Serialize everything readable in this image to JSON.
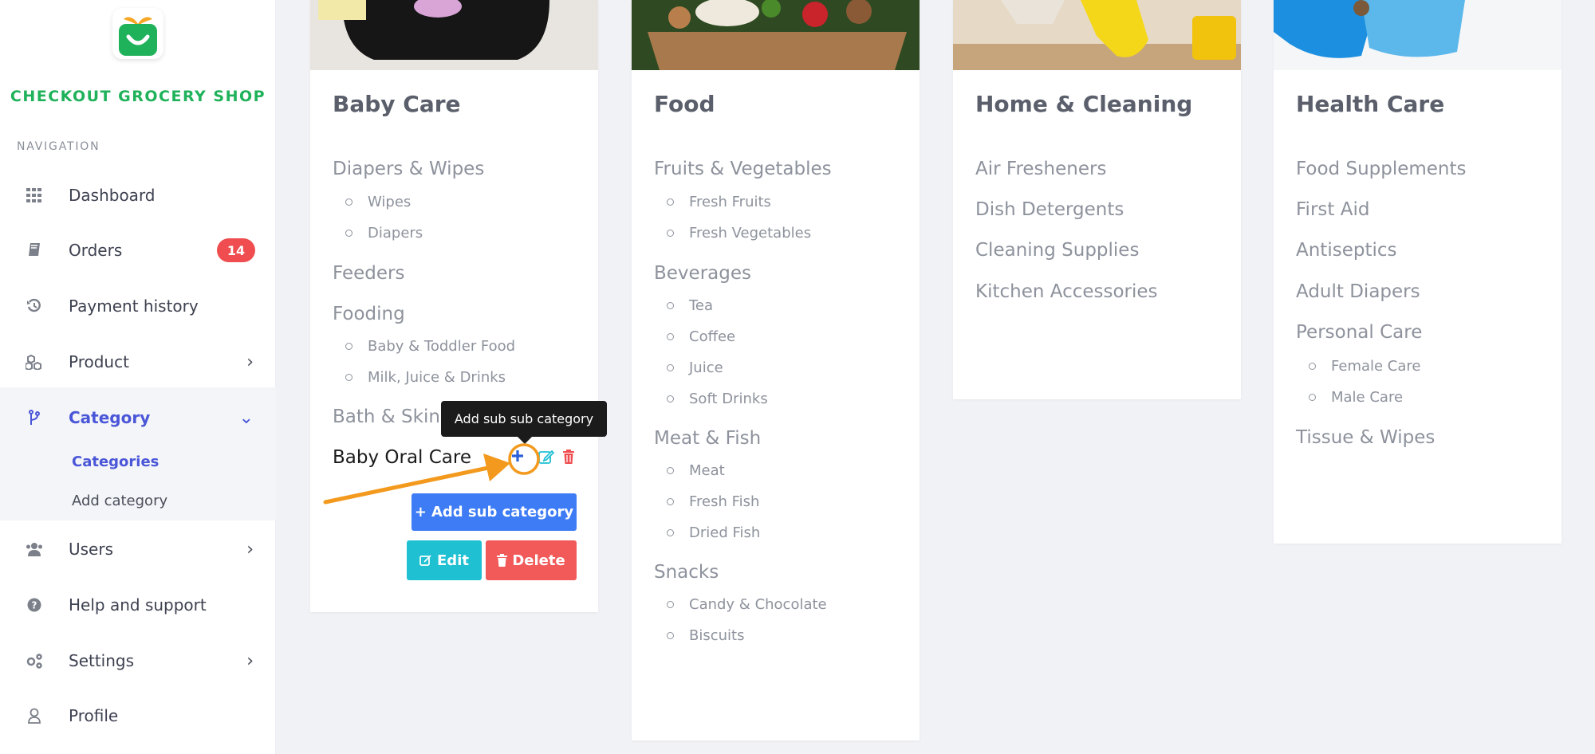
{
  "brand": {
    "name": "CHECKOUT GROCERY SHOP"
  },
  "sidebar": {
    "section_heading": "NAVIGATION",
    "items": [
      {
        "label": "Dashboard",
        "icon": "grid-icon"
      },
      {
        "label": "Orders",
        "icon": "book-icon",
        "badge": "14"
      },
      {
        "label": "Payment history",
        "icon": "history-icon"
      },
      {
        "label": "Product",
        "icon": "cubes-icon"
      },
      {
        "label": "Category",
        "icon": "branch-icon",
        "expanded": true,
        "subitems": [
          {
            "label": "Categories",
            "active": true
          },
          {
            "label": "Add category"
          }
        ]
      },
      {
        "label": "Users",
        "icon": "users-icon"
      },
      {
        "label": "Help and support",
        "icon": "question-circle-icon"
      },
      {
        "label": "Settings",
        "icon": "gears-icon"
      },
      {
        "label": "Profile",
        "icon": "user-outline-icon"
      }
    ]
  },
  "categories": {
    "baby_care": {
      "title": "Baby Care",
      "groups": [
        {
          "name": "Diapers & Wipes",
          "children": [
            "Wipes",
            "Diapers"
          ]
        },
        {
          "name": "Feeders",
          "children": []
        },
        {
          "name": "Fooding",
          "children": [
            "Baby & Toddler Food",
            "Milk, Juice & Drinks"
          ]
        },
        {
          "name": "Bath & Skincare",
          "children": []
        },
        {
          "name": "Baby Oral Care",
          "children": []
        }
      ],
      "add_sub_label": "Add sub category",
      "edit_label": "Edit",
      "delete_label": "Delete",
      "tooltip": "Add sub sub category"
    },
    "food": {
      "title": "Food",
      "groups": [
        {
          "name": "Fruits & Vegetables",
          "children": [
            "Fresh Fruits",
            "Fresh Vegetables"
          ]
        },
        {
          "name": "Beverages",
          "children": [
            "Tea",
            "Coffee",
            "Juice",
            "Soft Drinks"
          ]
        },
        {
          "name": "Meat & Fish",
          "children": [
            "Meat",
            "Fresh Fish",
            "Dried Fish"
          ]
        },
        {
          "name": "Snacks",
          "children": [
            "Candy & Chocolate",
            "Biscuits"
          ]
        }
      ]
    },
    "home_cleaning": {
      "title": "Home & Cleaning",
      "groups": [
        {
          "name": "Air Fresheners"
        },
        {
          "name": "Dish Detergents"
        },
        {
          "name": "Cleaning Supplies"
        },
        {
          "name": "Kitchen Accessories"
        }
      ]
    },
    "health_care": {
      "title": "Health Care",
      "groups": [
        {
          "name": "Food Supplements",
          "children": []
        },
        {
          "name": "First Aid",
          "children": []
        },
        {
          "name": "Antiseptics",
          "children": []
        },
        {
          "name": "Adult Diapers",
          "children": []
        },
        {
          "name": "Personal Care",
          "children": [
            "Female Care",
            "Male Care"
          ]
        },
        {
          "name": "Tissue & Wipes",
          "children": []
        }
      ]
    }
  },
  "colors": {
    "brand_green": "#1fb25a",
    "accent_indigo": "#4a56d8",
    "blue_button": "#3d7cf5",
    "teal_button": "#1fc0d2",
    "red_button": "#f25a5a",
    "highlight_orange": "#f39a1e"
  }
}
